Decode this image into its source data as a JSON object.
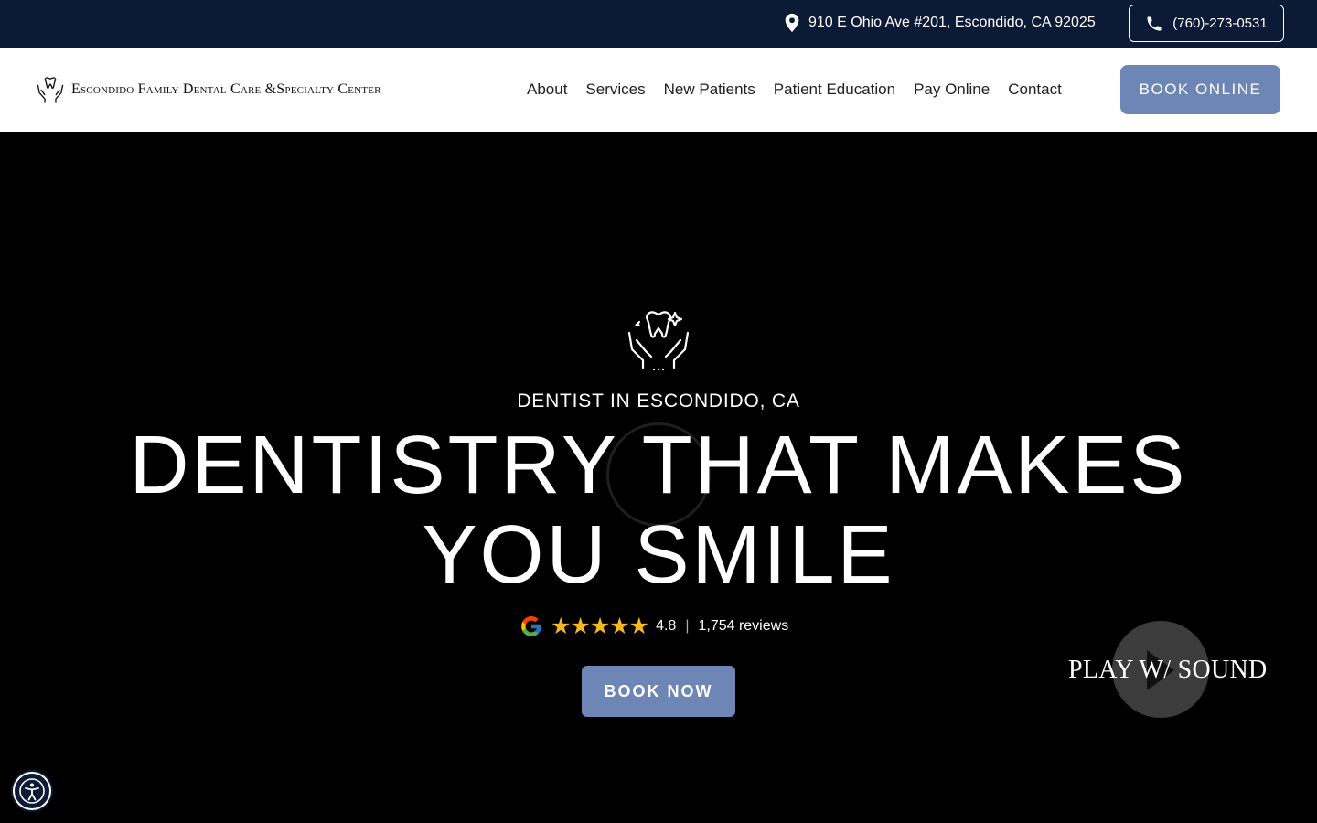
{
  "topbar": {
    "address": "910 E Ohio Ave #201, Escondido, CA 92025",
    "phone": "(760)-273-0531",
    "pin_icon": "map-pin-icon",
    "phone_icon": "phone-icon"
  },
  "header": {
    "logo_text": "Escondido Family Dental Care &Specialty Center",
    "nav": [
      "About",
      "Services",
      "New Patients",
      "Patient Education",
      "Pay Online",
      "Contact"
    ],
    "book_online": "BOOK ONLINE"
  },
  "hero": {
    "eyebrow": "DENTIST IN ESCONDIDO, CA",
    "headline_line1": "DENTISTRY THAT MAKES",
    "headline_line2": "YOU SMILE",
    "rating": "4.8",
    "stars": "★★★★★",
    "reviews": "1,754 reviews",
    "book_now": "BOOK NOW",
    "play_label": "PLAY W/ SOUND"
  },
  "colors": {
    "topbar_bg": "#0d1a36",
    "accent": "#6e86b5",
    "star": "#f5b820"
  }
}
